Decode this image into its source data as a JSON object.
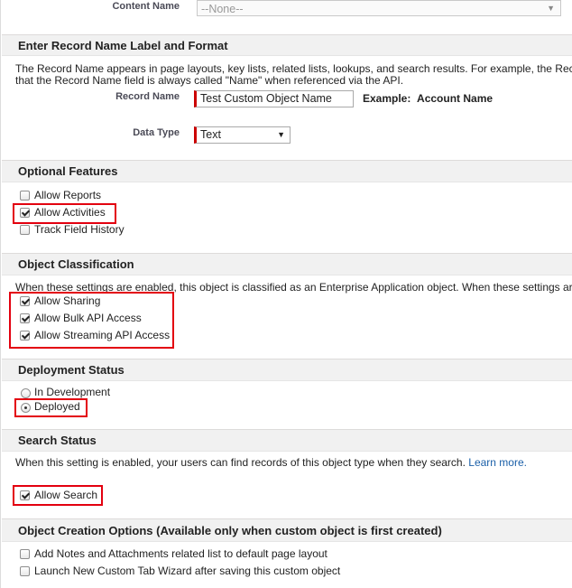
{
  "content_name": {
    "label": "Content Name",
    "value": "--None--"
  },
  "record_name": {
    "header": "Enter Record Name Label and Format",
    "desc_line1": "The Record Name appears in page layouts, key lists, related lists, lookups, and search results. For example, the Rec",
    "desc_line2": "that the Record Name field is always called \"Name\" when referenced via the API.",
    "label": "Record Name",
    "value": "Test Custom Object Name",
    "example_label": "Example:",
    "example_value": "Account Name",
    "data_type_label": "Data Type",
    "data_type_value": "Text"
  },
  "optional_features": {
    "header": "Optional Features",
    "items": [
      {
        "label": "Allow Reports",
        "checked": false
      },
      {
        "label": "Allow Activities",
        "checked": true
      },
      {
        "label": "Track Field History",
        "checked": false
      }
    ]
  },
  "object_classification": {
    "header": "Object Classification",
    "desc": "When these settings are enabled, this object is classified as an Enterprise Application object. When these settings ar",
    "items": [
      {
        "label": "Allow Sharing",
        "checked": true
      },
      {
        "label": "Allow Bulk API Access",
        "checked": true
      },
      {
        "label": "Allow Streaming API Access",
        "checked": true
      }
    ]
  },
  "deployment_status": {
    "header": "Deployment Status",
    "options": [
      {
        "label": "In Development",
        "selected": false
      },
      {
        "label": "Deployed",
        "selected": true
      }
    ]
  },
  "search_status": {
    "header": "Search Status",
    "desc": "When this setting is enabled, your users can find records of this object type when they search.",
    "learn_more": "Learn more.",
    "item": {
      "label": "Allow Search",
      "checked": true
    }
  },
  "creation_options": {
    "header": "Object Creation Options (Available only when custom object is first created)",
    "items": [
      {
        "label": "Add Notes and Attachments related list to default page layout",
        "checked": false
      },
      {
        "label": "Launch New Custom Tab Wizard after saving this custom object",
        "checked": false
      }
    ]
  },
  "colors": {
    "highlight": "#e3000f",
    "required": "#cc0000",
    "link": "#1a5fa8"
  }
}
